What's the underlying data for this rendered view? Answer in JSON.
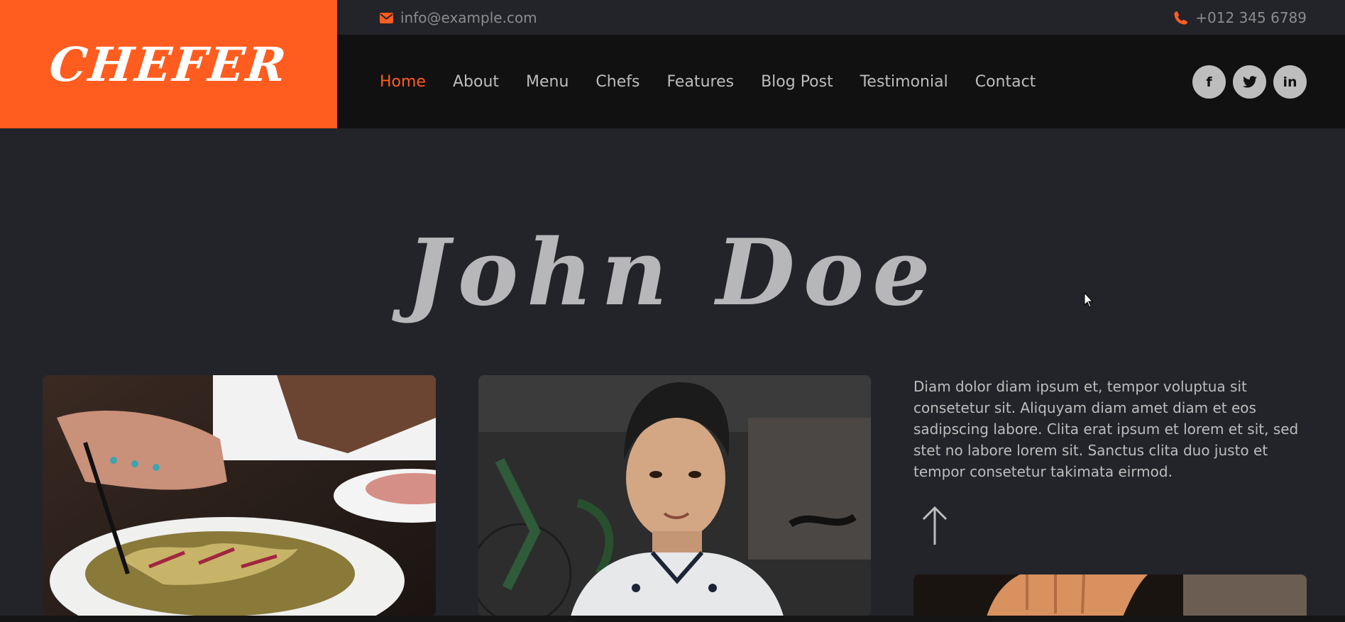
{
  "brand": {
    "name": "CHEFER"
  },
  "topbar": {
    "email": "info@example.com",
    "phone": "+012 345 6789"
  },
  "nav": {
    "items": [
      {
        "label": "Home",
        "active": true
      },
      {
        "label": "About"
      },
      {
        "label": "Menu"
      },
      {
        "label": "Chefs"
      },
      {
        "label": "Features"
      },
      {
        "label": "Blog Post"
      },
      {
        "label": "Testimonial"
      },
      {
        "label": "Contact"
      }
    ]
  },
  "social": {
    "facebook": "f",
    "twitter": "twitter-icon",
    "linkedin": "in"
  },
  "hero": {
    "title": "John Doe"
  },
  "bio": {
    "text": "Diam dolor diam ipsum et, tempor voluptua sit consetetur sit. Aliquyam diam amet diam et eos sadipscing labore. Clita erat ipsum et lorem et sit, sed stet no labore lorem sit. Sanctus clita duo justo et tempor consetetur takimata eirmod."
  },
  "colors": {
    "accent": "#ff5c1f",
    "background": "#23242a",
    "navbar": "#111111",
    "text": "#bdbdbd"
  }
}
